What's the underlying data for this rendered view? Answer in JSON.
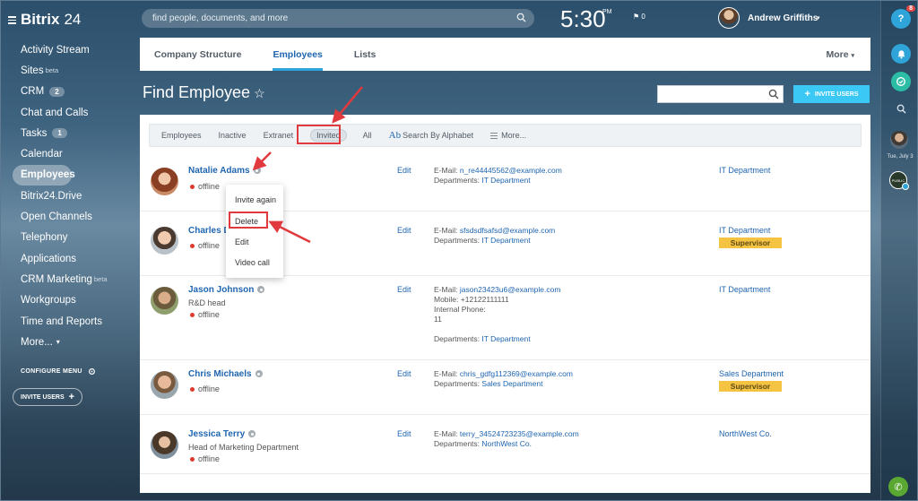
{
  "app": {
    "brand": "Bitrix",
    "brand_num": "24"
  },
  "sidebar": {
    "items": [
      {
        "label": "Activity Stream"
      },
      {
        "label": "Sites",
        "sup": "beta"
      },
      {
        "label": "CRM",
        "counter": "2"
      },
      {
        "label": "Chat and Calls"
      },
      {
        "label": "Tasks",
        "counter": "1"
      },
      {
        "label": "Calendar"
      },
      {
        "label": "Employees",
        "active": true
      },
      {
        "label": "Bitrix24.Drive"
      },
      {
        "label": "Open Channels"
      },
      {
        "label": "Telephony"
      },
      {
        "label": "Applications"
      },
      {
        "label": "CRM Marketing",
        "sup": "beta"
      },
      {
        "label": "Workgroups"
      },
      {
        "label": "Time and Reports"
      },
      {
        "label": "More..."
      }
    ],
    "configure_menu": "CONFIGURE MENU",
    "invite_users": "INVITE USERS"
  },
  "header": {
    "search_placeholder": "find people, documents, and more",
    "time": "5:30",
    "ampm": "PM",
    "flag_count": "0",
    "user_name": "Andrew Griffiths"
  },
  "rail": {
    "help_badge": "8",
    "date_label": "Tue, July 3",
    "chat_label": "PUBLIC"
  },
  "tabs": [
    {
      "label": "Company Structure"
    },
    {
      "label": "Employees",
      "active": true
    },
    {
      "label": "Lists"
    }
  ],
  "tabs_more": "More",
  "page": {
    "title": "Find Employee",
    "invite_button": "INVITE USERS"
  },
  "filters": {
    "items": [
      "Employees",
      "Inactive",
      "Extranet",
      "Invited",
      "All"
    ],
    "alphabet_icon": "Ab",
    "alphabet": "Search By Alphabet",
    "more": "More..."
  },
  "employees": [
    {
      "name": "Natalie Adams",
      "position": "",
      "status": "offline",
      "edit": "Edit",
      "email_label": "E-Mail:",
      "email": "n_re44445562@example.com",
      "dept_label": "Departments:",
      "dept_link": "IT Department",
      "department": "IT Department"
    },
    {
      "name": "Charles D",
      "status": "offline",
      "edit": "Edit",
      "email_label": "E-Mail:",
      "email": "sfsdsdfsafsd@example.com",
      "dept_label": "Departments:",
      "dept_link": "IT Department",
      "department": "IT Department",
      "badge": "Supervisor"
    },
    {
      "name": "Jason Johnson",
      "position": "R&D head",
      "status": "offline",
      "edit": "Edit",
      "email_label": "E-Mail:",
      "email": "jason23423u6@example.com",
      "mobile_label": "Mobile:",
      "mobile": "+12122111111",
      "internal_label": "Internal Phone:",
      "internal": "11",
      "dept_label": "Departments:",
      "dept_link": "IT Department",
      "department": "IT Department"
    },
    {
      "name": "Chris Michaels",
      "status": "offline",
      "edit": "Edit",
      "email_label": "E-Mail:",
      "email": "chris_gdfg112369@example.com",
      "dept_label": "Departments:",
      "dept_link": "Sales Department",
      "department": "Sales Department",
      "badge": "Supervisor"
    },
    {
      "name": "Jessica Terry",
      "position": "Head of Marketing Department",
      "status": "offline",
      "edit": "Edit",
      "email_label": "E-Mail:",
      "email": "terry_34524723235@example.com",
      "dept_label": "Departments:",
      "dept_link": "NorthWest Co.",
      "department": "NorthWest Co."
    }
  ],
  "context_menu": [
    "Invite again",
    "Delete",
    "Edit",
    "Video call"
  ],
  "colors": {
    "accent": "#2fa4d8",
    "link": "#2066b0",
    "invite_button": "#3bc8f5",
    "supervisor_badge": "#f5c342",
    "highlight": "#e0393e",
    "offline_dot": "#e03a2f"
  }
}
